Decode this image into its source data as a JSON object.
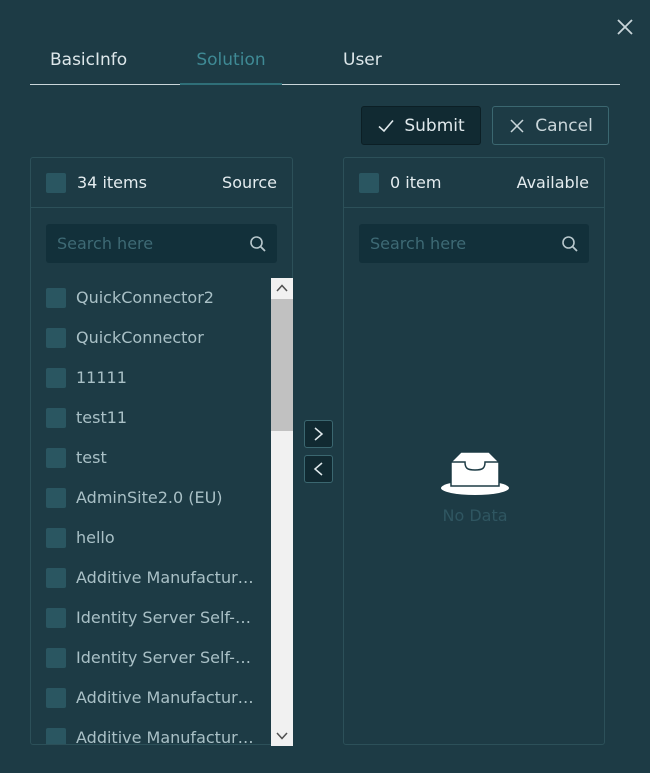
{
  "tabs": [
    {
      "label": "BasicInfo"
    },
    {
      "label": "Solution"
    },
    {
      "label": "User"
    }
  ],
  "actions": {
    "submit_label": "Submit",
    "cancel_label": "Cancel"
  },
  "source": {
    "count_label": "34 items",
    "title": "Source",
    "search_placeholder": "Search here",
    "items": [
      {
        "label": "QuickConnector2"
      },
      {
        "label": "QuickConnector"
      },
      {
        "label": "11111"
      },
      {
        "label": "test11"
      },
      {
        "label": "test"
      },
      {
        "label": "AdminSite2.0 (EU)"
      },
      {
        "label": "hello"
      },
      {
        "label": "Additive Manufacturi..."
      },
      {
        "label": "Identity Server Self-H..."
      },
      {
        "label": "Identity Server Self-H..."
      },
      {
        "label": "Additive Manufacturi..."
      },
      {
        "label": "Additive Manufacturi..."
      }
    ]
  },
  "target": {
    "count_label": "0 item",
    "title": "Available",
    "search_placeholder": "Search here",
    "empty_text": "No Data"
  },
  "colors": {
    "background": "#1d3b45",
    "active_tab": "#3f8a95",
    "checkbox": "#2a5661",
    "search_bg": "#12303a"
  },
  "icons": {
    "close": "close-icon",
    "submit": "check-icon",
    "cancel": "x-icon",
    "search": "search-icon",
    "move_right": "chevron-right-icon",
    "move_left": "chevron-left-icon",
    "empty": "empty-inbox-icon"
  }
}
